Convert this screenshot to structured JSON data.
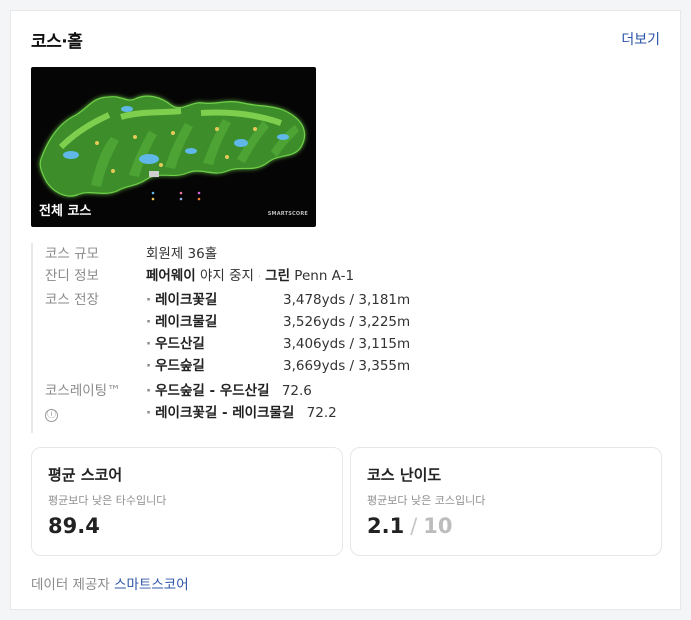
{
  "header": {
    "title": "코스·홀",
    "more": "더보기"
  },
  "thumbnail": {
    "label": "전체 코스",
    "watermark": "SMARTSCORE"
  },
  "info": {
    "scale_label": "코스 규모",
    "scale_value": "회원제 36홀",
    "turf_label": "잔디 정보",
    "turf_fairway": "페어웨이",
    "turf_fairway_type": "야지 중지",
    "turf_green": "그린",
    "turf_green_type": "Penn A-1",
    "length_label": "코스 전장",
    "courses": [
      {
        "name": "레이크꽃길",
        "length": "3,478yds / 3,181m"
      },
      {
        "name": "레이크물길",
        "length": "3,526yds / 3,225m"
      },
      {
        "name": "우드산길",
        "length": "3,406yds / 3,115m"
      },
      {
        "name": "우드숲길",
        "length": "3,669yds / 3,355m"
      }
    ],
    "rating_label": "코스레이팅™",
    "rating_icon": "ⓘ",
    "ratings": [
      {
        "name": "우드숲길 - 우드산길",
        "value": "72.6"
      },
      {
        "name": "레이크꽃길 - 레이크물길",
        "value": "72.2"
      }
    ]
  },
  "stats": {
    "avg": {
      "title": "평균 스코어",
      "desc": "평균보다 낮은 타수입니다",
      "value": "89.4"
    },
    "difficulty": {
      "title": "코스 난이도",
      "desc": "평균보다 낮은 코스입니다",
      "value": "2.1",
      "slash": "/",
      "max": "10"
    }
  },
  "footer": {
    "label": "데이터 제공자",
    "provider": "스마트스코어"
  },
  "colors": {
    "link": "#2c54a8",
    "map_green": "#3e8e2a",
    "map_bg": "#050505"
  },
  "icons": {
    "info": "info-icon"
  }
}
